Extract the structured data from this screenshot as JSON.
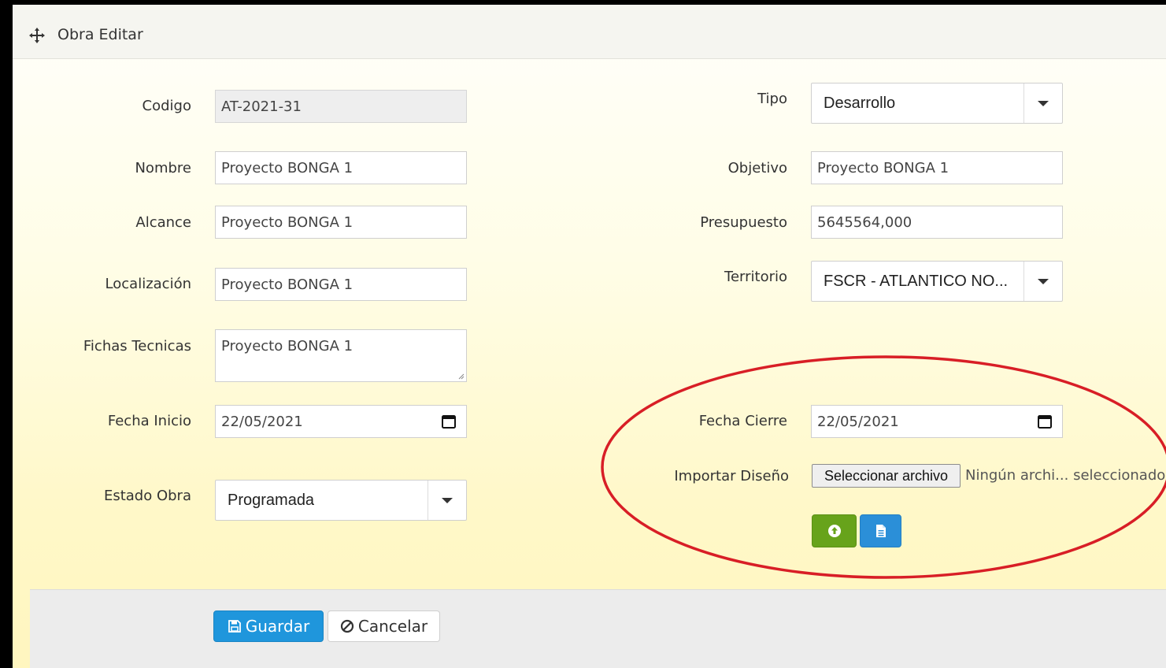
{
  "header": {
    "title": "Obra Editar"
  },
  "form": {
    "codigo": {
      "label": "Codigo",
      "value": "AT-2021-31"
    },
    "nombre": {
      "label": "Nombre",
      "value": "Proyecto BONGA 1"
    },
    "alcance": {
      "label": "Alcance",
      "value": "Proyecto BONGA 1"
    },
    "localizacion": {
      "label": "Localización",
      "value": "Proyecto BONGA 1"
    },
    "fichas": {
      "label": "Fichas Tecnicas",
      "value": "Proyecto BONGA 1"
    },
    "fecha_inicio": {
      "label": "Fecha Inicio",
      "value": "22/05/2021"
    },
    "estado": {
      "label": "Estado Obra",
      "value": "Programada"
    },
    "tipo": {
      "label": "Tipo",
      "value": "Desarrollo"
    },
    "objetivo": {
      "label": "Objetivo",
      "value": "Proyecto BONGA 1"
    },
    "presupuesto": {
      "label": "Presupuesto",
      "value": "5645564,000"
    },
    "territorio": {
      "label": "Territorio",
      "value": "FSCR - ATLANTICO NO..."
    },
    "fecha_cierre": {
      "label": "Fecha Cierre",
      "value": "22/05/2021"
    },
    "importar": {
      "label": "Importar Diseño",
      "button": "Seleccionar archivo",
      "status": "Ningún archi... seleccionado"
    }
  },
  "footer": {
    "save": "Guardar",
    "cancel": "Cancelar"
  },
  "colors": {
    "highlight": "#d81e26",
    "save": "#1f96dc",
    "upload": "#67a31b",
    "file": "#2b8fd8"
  },
  "icons": {
    "header": "move-arrows-icon",
    "upload": "circle-arrow-up-icon",
    "file": "file-icon",
    "save": "floppy-icon",
    "cancel": "ban-icon"
  }
}
